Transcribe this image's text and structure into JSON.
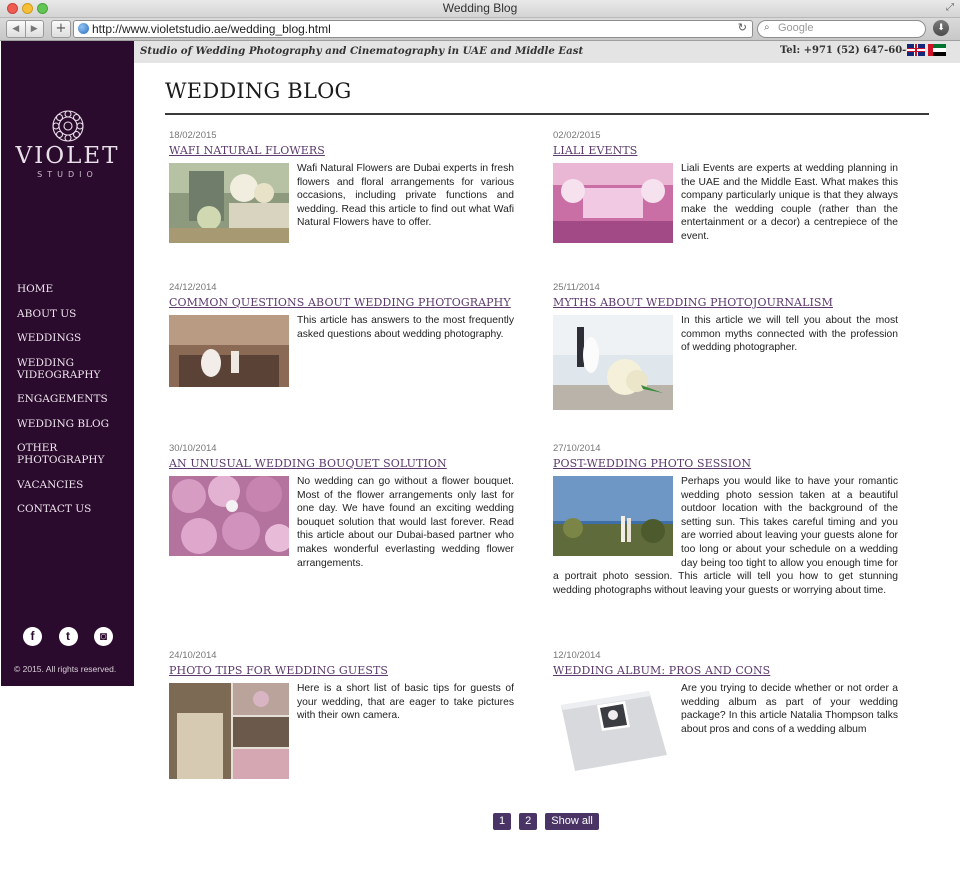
{
  "browser": {
    "window_title": "Wedding Blog",
    "url": "http://www.violetstudio.ae/wedding_blog.html",
    "search_placeholder": "Google"
  },
  "topbar": {
    "tagline": "Studio of Wedding Photography and Cinematography in UAE and Middle East",
    "phone": "Tel: +971 (52) 647-60-07"
  },
  "sidebar": {
    "logo_text": "VIOLET",
    "logo_sub": "STUDIO",
    "nav": [
      {
        "label": "HOME"
      },
      {
        "label": "ABOUT US"
      },
      {
        "label": "WEDDINGS"
      },
      {
        "label": "WEDDING VIDEOGRAPHY"
      },
      {
        "label": "ENGAGEMENTS"
      },
      {
        "label": "WEDDING BLOG"
      },
      {
        "label": "OTHER PHOTOGRAPHY"
      },
      {
        "label": "VACANCIES"
      },
      {
        "label": "CONTACT US"
      }
    ],
    "social": [
      "facebook-icon",
      "twitter-icon",
      "instagram-icon"
    ],
    "copyright": "© 2015. All rights reserved."
  },
  "page": {
    "title": "WEDDING BLOG"
  },
  "posts": [
    {
      "date": "18/02/2015",
      "title": "WAFI NATURAL FLOWERS",
      "excerpt": "Wafi Natural Flowers are Dubai experts in fresh flowers and floral arrangements for various occasions, including private functions and wedding. Read this article to find out what Wafi Natural Flowers have to offer."
    },
    {
      "date": "02/02/2015",
      "title": "LIALI EVENTS",
      "excerpt": "Liali Events are experts at wedding planning in the UAE and the Middle East. What makes this company particularly unique is that they always make the wedding couple (rather than the entertainment or a decor) a centrepiece of the event."
    },
    {
      "date": "24/12/2014",
      "title": "COMMON QUESTIONS ABOUT WEDDING PHOTOGRAPHY",
      "excerpt": "This article has answers to the most frequently asked questions about wedding photography."
    },
    {
      "date": "25/11/2014",
      "title": "MYTHS ABOUT WEDDING PHOTOJOURNALISM",
      "excerpt": "In this article we will tell you about the most common myths connected with the profession of wedding photographer."
    },
    {
      "date": "30/10/2014",
      "title": "AN UNUSUAL WEDDING BOUQUET SOLUTION",
      "excerpt": "No wedding can go without a flower bouquet. Most of the flower arrangements only last for one day. We have found an exciting wedding bouquet solution that would last forever. Read this article about our Dubai-based partner who makes wonderful everlasting wedding flower arrangements."
    },
    {
      "date": "27/10/2014",
      "title": "POST-WEDDING PHOTO SESSION",
      "excerpt": "Perhaps you would like to have your romantic wedding photo session taken at a beautiful outdoor location with the background of the setting sun. This takes careful timing and you are worried about leaving your guests alone for too long or about your schedule on a wedding day being too tight to allow you enough time for a portrait photo session. This article will tell you how to get stunning wedding photographs without leaving your guests or worrying about time."
    },
    {
      "date": "24/10/2014",
      "title": "PHOTO TIPS FOR WEDDING GUESTS",
      "excerpt": "Here is a short list of basic tips for guests of your wedding, that are eager to take pictures with their own camera."
    },
    {
      "date": "12/10/2014",
      "title": "WEDDING ALBUM: PROS AND CONS",
      "excerpt": "Are you trying to decide whether or not order a wedding album as part of your wedding package? In this article Natalia Thompson talks about pros and cons of a wedding album"
    }
  ],
  "pagination": {
    "pages": [
      "1",
      "2"
    ],
    "show_all": "Show all"
  }
}
